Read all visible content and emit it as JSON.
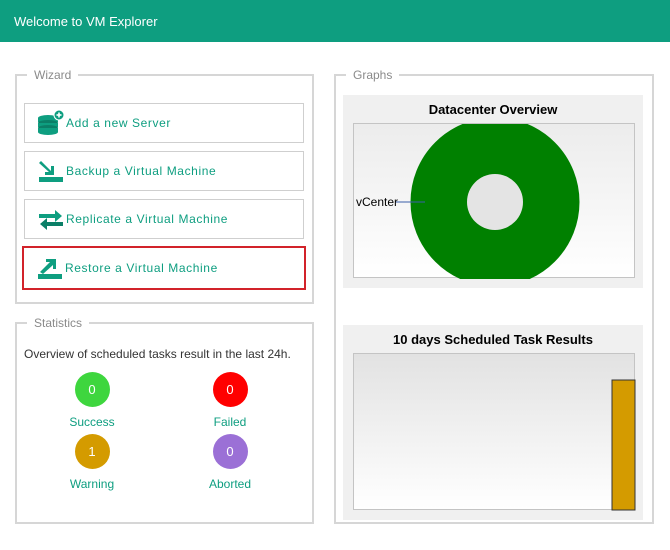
{
  "window": {
    "title": "Welcome to VM Explorer"
  },
  "wizard": {
    "legend": "Wizard",
    "items": [
      {
        "label": "Add a new Server",
        "icon": "server-add-icon"
      },
      {
        "label": "Backup a Virtual Machine",
        "icon": "backup-icon"
      },
      {
        "label": "Replicate a Virtual Machine",
        "icon": "replicate-icon"
      },
      {
        "label": "Restore a Virtual Machine",
        "icon": "restore-icon",
        "selected": true
      }
    ]
  },
  "statistics": {
    "legend": "Statistics",
    "description": "Overview of scheduled tasks result in the last 24h.",
    "items": [
      {
        "label": "Success",
        "value": "0",
        "color": "#3ed63e"
      },
      {
        "label": "Failed",
        "value": "0",
        "color": "#ff0000"
      },
      {
        "label": "Warning",
        "value": "1",
        "color": "#d49b00"
      },
      {
        "label": "Aborted",
        "value": "0",
        "color": "#9b70d6"
      }
    ]
  },
  "graphs": {
    "legend": "Graphs"
  },
  "colors": {
    "accent": "#0e9e80",
    "donut": "#008000",
    "bar": "#d49b00",
    "selected_border": "#d2232a"
  },
  "chart_data": [
    {
      "type": "pie",
      "title": "Datacenter Overview",
      "labels": [
        "vCenter"
      ],
      "values": [
        1
      ],
      "donut": true
    },
    {
      "type": "bar",
      "title": "10 days Scheduled Task Results",
      "series": [
        {
          "values": [
            1
          ]
        }
      ]
    }
  ]
}
